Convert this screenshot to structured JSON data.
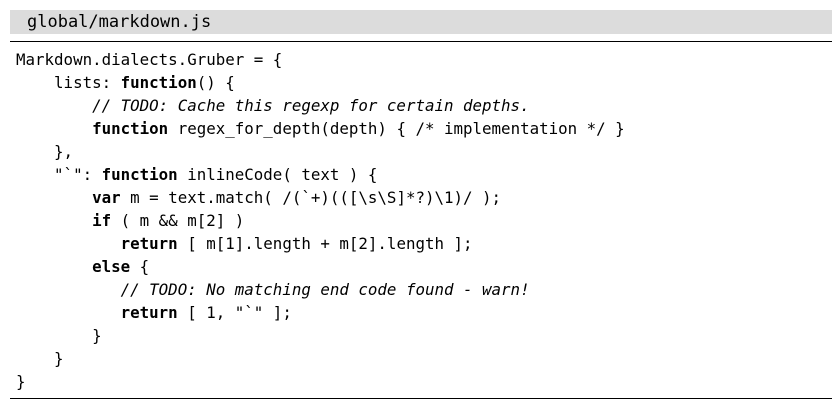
{
  "file": {
    "title": "global/markdown.js"
  },
  "code": {
    "lines": [
      [
        {
          "t": "Markdown.dialects.Gruber = {"
        }
      ],
      [
        {
          "t": "    lists: "
        },
        {
          "t": "function",
          "kw": true
        },
        {
          "t": "() {"
        }
      ],
      [
        {
          "t": "        "
        },
        {
          "t": "// TODO: Cache this regexp for certain depths.",
          "cm": true
        }
      ],
      [
        {
          "t": "        "
        },
        {
          "t": "function",
          "kw": true
        },
        {
          "t": " regex_for_depth(depth) { /* implementation */ }"
        }
      ],
      [
        {
          "t": "    },"
        }
      ],
      [
        {
          "t": "    \"`\": "
        },
        {
          "t": "function",
          "kw": true
        },
        {
          "t": " inlineCode( text ) {"
        }
      ],
      [
        {
          "t": "        "
        },
        {
          "t": "var",
          "kw": true
        },
        {
          "t": " m = text.match( /(`+)(([\\s\\S]*?)\\1)/ );"
        }
      ],
      [
        {
          "t": "        "
        },
        {
          "t": "if",
          "kw": true
        },
        {
          "t": " ( m && m[2] )"
        }
      ],
      [
        {
          "t": "           "
        },
        {
          "t": "return",
          "kw": true
        },
        {
          "t": " [ m[1].length + m[2].length ];"
        }
      ],
      [
        {
          "t": "        "
        },
        {
          "t": "else",
          "kw": true
        },
        {
          "t": " {"
        }
      ],
      [
        {
          "t": "           "
        },
        {
          "t": "// TODO: No matching end code found - warn!",
          "cm": true
        }
      ],
      [
        {
          "t": "           "
        },
        {
          "t": "return",
          "kw": true
        },
        {
          "t": " [ 1, \"`\" ];"
        }
      ],
      [
        {
          "t": "        }"
        }
      ],
      [
        {
          "t": "    }"
        }
      ],
      [
        {
          "t": "}"
        }
      ]
    ]
  }
}
